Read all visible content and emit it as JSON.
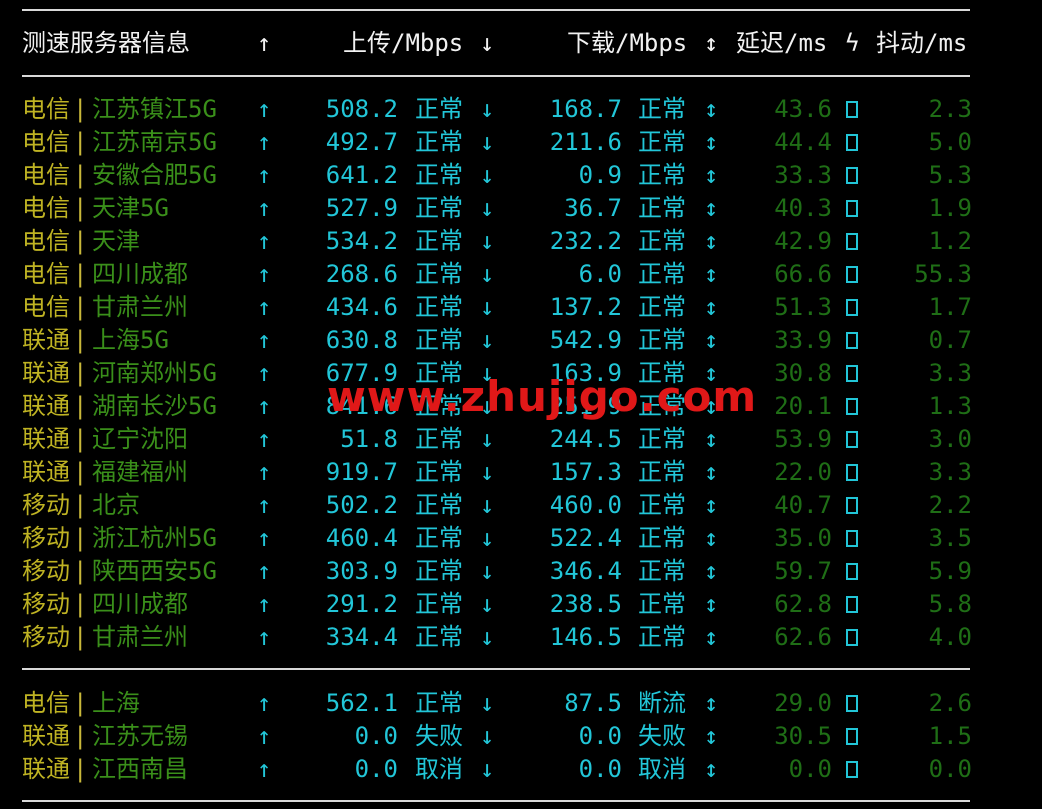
{
  "header": {
    "col_server": "测速服务器信息",
    "up_arrow": "↑",
    "col_upload": "上传/Mbps",
    "down_arrow": "↓",
    "col_download": "下载/Mbps",
    "updown_arrow": "↕",
    "col_latency": "延迟/ms",
    "bolt": "ϟ",
    "col_jitter": "抖动/ms"
  },
  "separator": "----------------------------------------------------------------------------",
  "rows": [
    {
      "isp": "电信",
      "loc": "江苏镇江5G",
      "up": "508.2",
      "up_status": "正常",
      "down": "168.7",
      "down_status": "正常",
      "latency": "43.6",
      "jitter": "2.3"
    },
    {
      "isp": "电信",
      "loc": "江苏南京5G",
      "up": "492.7",
      "up_status": "正常",
      "down": "211.6",
      "down_status": "正常",
      "latency": "44.4",
      "jitter": "5.0"
    },
    {
      "isp": "电信",
      "loc": "安徽合肥5G",
      "up": "641.2",
      "up_status": "正常",
      "down": "0.9",
      "down_status": "正常",
      "latency": "33.3",
      "jitter": "5.3"
    },
    {
      "isp": "电信",
      "loc": "天津5G",
      "up": "527.9",
      "up_status": "正常",
      "down": "36.7",
      "down_status": "正常",
      "latency": "40.3",
      "jitter": "1.9"
    },
    {
      "isp": "电信",
      "loc": "天津",
      "up": "534.2",
      "up_status": "正常",
      "down": "232.2",
      "down_status": "正常",
      "latency": "42.9",
      "jitter": "1.2"
    },
    {
      "isp": "电信",
      "loc": "四川成都",
      "up": "268.6",
      "up_status": "正常",
      "down": "6.0",
      "down_status": "正常",
      "latency": "66.6",
      "jitter": "55.3"
    },
    {
      "isp": "电信",
      "loc": "甘肃兰州",
      "up": "434.6",
      "up_status": "正常",
      "down": "137.2",
      "down_status": "正常",
      "latency": "51.3",
      "jitter": "1.7"
    },
    {
      "isp": "联通",
      "loc": "上海5G",
      "up": "630.8",
      "up_status": "正常",
      "down": "542.9",
      "down_status": "正常",
      "latency": "33.9",
      "jitter": "0.7"
    },
    {
      "isp": "联通",
      "loc": "河南郑州5G",
      "up": "677.9",
      "up_status": "正常",
      "down": "163.9",
      "down_status": "正常",
      "latency": "30.8",
      "jitter": "3.3"
    },
    {
      "isp": "联通",
      "loc": "湖南长沙5G",
      "up": "841.6",
      "up_status": "正常",
      "down": "251.9",
      "down_status": "正常",
      "latency": "20.1",
      "jitter": "1.3"
    },
    {
      "isp": "联通",
      "loc": "辽宁沈阳",
      "up": "51.8",
      "up_status": "正常",
      "down": "244.5",
      "down_status": "正常",
      "latency": "53.9",
      "jitter": "3.0"
    },
    {
      "isp": "联通",
      "loc": "福建福州",
      "up": "919.7",
      "up_status": "正常",
      "down": "157.3",
      "down_status": "正常",
      "latency": "22.0",
      "jitter": "3.3"
    },
    {
      "isp": "移动",
      "loc": "北京",
      "up": "502.2",
      "up_status": "正常",
      "down": "460.0",
      "down_status": "正常",
      "latency": "40.7",
      "jitter": "2.2"
    },
    {
      "isp": "移动",
      "loc": "浙江杭州5G",
      "up": "460.4",
      "up_status": "正常",
      "down": "522.4",
      "down_status": "正常",
      "latency": "35.0",
      "jitter": "3.5"
    },
    {
      "isp": "移动",
      "loc": "陕西西安5G",
      "up": "303.9",
      "up_status": "正常",
      "down": "346.4",
      "down_status": "正常",
      "latency": "59.7",
      "jitter": "5.9"
    },
    {
      "isp": "移动",
      "loc": "四川成都",
      "up": "291.2",
      "up_status": "正常",
      "down": "238.5",
      "down_status": "正常",
      "latency": "62.8",
      "jitter": "5.8"
    },
    {
      "isp": "移动",
      "loc": "甘肃兰州",
      "up": "334.4",
      "up_status": "正常",
      "down": "146.5",
      "down_status": "正常",
      "latency": "62.6",
      "jitter": "4.0"
    }
  ],
  "rows2": [
    {
      "isp": "电信",
      "loc": "上海",
      "up": "562.1",
      "up_status": "正常",
      "down": "87.5",
      "down_status": "断流",
      "latency": "29.0",
      "jitter": "2.6"
    },
    {
      "isp": "联通",
      "loc": "江苏无锡",
      "up": "0.0",
      "up_status": "失败",
      "down": "0.0",
      "down_status": "失败",
      "latency": "30.5",
      "jitter": "1.5"
    },
    {
      "isp": "联通",
      "loc": "江西南昌",
      "up": "0.0",
      "up_status": "取消",
      "down": "0.0",
      "down_status": "取消",
      "latency": "0.0",
      "jitter": "0.0"
    }
  ],
  "watermark": "www.zhujigo.com",
  "colors": {
    "background": "#000000",
    "cyan": "#22c6d8",
    "yellow": "#bfb323",
    "green": "#3a8f1a",
    "watermark": "#e01818"
  }
}
